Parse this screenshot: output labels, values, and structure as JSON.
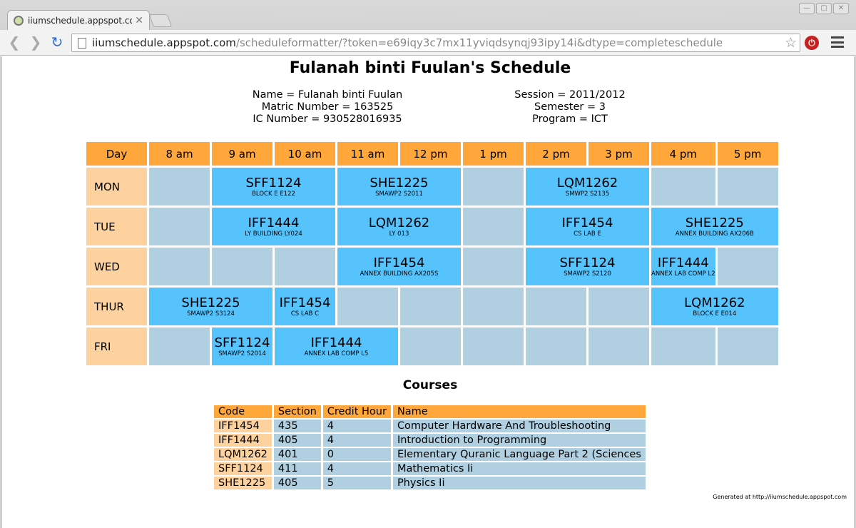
{
  "browser": {
    "tab_title": "iiumschedule.appspot.com",
    "url_host": "iiumschedule.appspot.com",
    "url_path": "/scheduleformatter/?token=e69iqy3c7mx11yviqdsynqj93ipy14i&dtype=completeschedule"
  },
  "page": {
    "title": "Fulanah binti Fuulan's Schedule",
    "info_left": [
      "Name = Fulanah binti Fuulan",
      "Matric Number = 163525",
      "IC Number = 930528016935"
    ],
    "info_right": [
      "Session = 2011/2012",
      "Semester = 3",
      "Program = ICT"
    ],
    "day_header": "Day",
    "hours": [
      "8 am",
      "9 am",
      "10 am",
      "11 am",
      "12 pm",
      "1 pm",
      "2 pm",
      "3 pm",
      "4 pm",
      "5 pm"
    ],
    "schedule": [
      {
        "day": "MON",
        "cells": [
          {
            "span": 1
          },
          {
            "span": 2,
            "code": "SFF1124",
            "loc": "BLOCK E E122"
          },
          {
            "span": 2,
            "code": "SHE1225",
            "loc": "SMAWP2 S2011"
          },
          {
            "span": 1
          },
          {
            "span": 2,
            "code": "LQM1262",
            "loc": "SMWP2 S2135"
          },
          {
            "span": 1
          },
          {
            "span": 1
          }
        ]
      },
      {
        "day": "TUE",
        "cells": [
          {
            "span": 1
          },
          {
            "span": 2,
            "code": "IFF1444",
            "loc": "LY BUILDING LY024"
          },
          {
            "span": 2,
            "code": "LQM1262",
            "loc": "LY 013"
          },
          {
            "span": 1
          },
          {
            "span": 2,
            "code": "IFF1454",
            "loc": "CS LAB E"
          },
          {
            "span": 2,
            "code": "SHE1225",
            "loc": "ANNEX BUILDING AX206B"
          }
        ]
      },
      {
        "day": "WED",
        "cells": [
          {
            "span": 1
          },
          {
            "span": 1
          },
          {
            "span": 1
          },
          {
            "span": 2,
            "code": "IFF1454",
            "loc": "ANNEX BUILDING AX205S"
          },
          {
            "span": 1
          },
          {
            "span": 2,
            "code": "SFF1124",
            "loc": "SMAWP2 S2120"
          },
          {
            "span": 1,
            "code": "IFF1444",
            "loc": "ANNEX LAB COMP L2"
          },
          {
            "span": 1
          }
        ]
      },
      {
        "day": "THUR",
        "cells": [
          {
            "span": 2,
            "code": "SHE1225",
            "loc": "SMAWP2 S3124"
          },
          {
            "span": 1,
            "code": "IFF1454",
            "loc": "CS LAB C"
          },
          {
            "span": 1
          },
          {
            "span": 1
          },
          {
            "span": 1
          },
          {
            "span": 1
          },
          {
            "span": 1
          },
          {
            "span": 2,
            "code": "LQM1262",
            "loc": "BLOCK E E014"
          }
        ]
      },
      {
        "day": "FRI",
        "cells": [
          {
            "span": 1
          },
          {
            "span": 1,
            "code": "SFF1124",
            "loc": "SMAWP2 S2014"
          },
          {
            "span": 2,
            "code": "IFF1444",
            "loc": "ANNEX LAB COMP L5"
          },
          {
            "span": 1
          },
          {
            "span": 1
          },
          {
            "span": 1
          },
          {
            "span": 1
          },
          {
            "span": 1
          },
          {
            "span": 1
          }
        ]
      }
    ],
    "courses_title": "Courses",
    "courses_headers": [
      "Code",
      "Section",
      "Credit Hour",
      "Name"
    ],
    "courses": [
      [
        "IFF1454",
        "435",
        "4",
        "Computer Hardware And Troubleshooting"
      ],
      [
        "IFF1444",
        "405",
        "4",
        "Introduction to Programming"
      ],
      [
        "LQM1262",
        "401",
        "0",
        "Elementary Quranic Language Part 2 (Sciences"
      ],
      [
        "SFF1124",
        "411",
        "4",
        "Mathematics Ii"
      ],
      [
        "SHE1225",
        "405",
        "5",
        "Physics Ii"
      ]
    ],
    "footer": "Generated at http://iiumschedule.appspot.com"
  },
  "colors": {
    "header": "#ffa73a",
    "day": "#fdd29e",
    "empty": "#b0d0e1",
    "class": "#56c3fd"
  }
}
